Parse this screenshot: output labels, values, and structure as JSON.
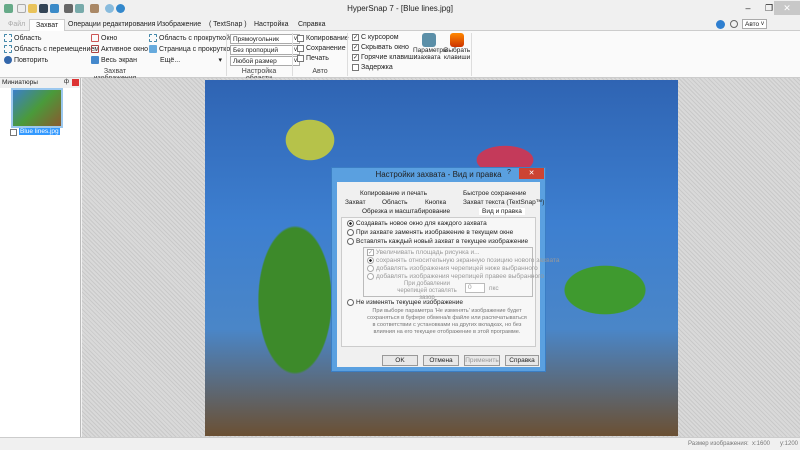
{
  "window": {
    "title": "HyperSnap 7 - [Blue lines.jpg]",
    "min": "–",
    "max": "❐",
    "close": "✕"
  },
  "tabs": [
    "Файл",
    "Захват",
    "Операции редактирования",
    "Изображение",
    "( TextSnap )",
    "Настройка",
    "Справка"
  ],
  "ribbon_right": {
    "zoom": "Авто"
  },
  "ribbon": {
    "capture": {
      "items": [
        "Область",
        "Область с перемещением",
        "Повторить",
        "Окно",
        "Активное окно",
        "Весь экран",
        "Область с прокруткой",
        "Страница с прокруткой",
        "Ещё..."
      ],
      "label": "Захват изображения"
    },
    "region": {
      "selects": [
        "Прямоугольник",
        "Без пропорций",
        "Любой размер"
      ],
      "label": "Настройка области"
    },
    "auto": {
      "items": [
        {
          "label": "Копирование",
          "checked": false
        },
        {
          "label": "Сохранение",
          "checked": false
        },
        {
          "label": "Печать",
          "checked": false
        }
      ],
      "label": "Авто"
    },
    "options": [
      {
        "label": "С курсором",
        "checked": true
      },
      {
        "label": "Скрывать окно",
        "checked": true
      },
      {
        "label": "Горячие клавиши",
        "checked": true
      },
      {
        "label": "Задержка",
        "checked": false
      }
    ],
    "big": [
      "Параметры захвата",
      "Выбрать клавиши"
    ]
  },
  "thumbs": {
    "title": "Миниатюры",
    "pin": "ф",
    "file": "Blue lines.jpg"
  },
  "dialog": {
    "title": "Настройки захвата - Вид и правка",
    "help": "?",
    "close": "✕",
    "tabs_row1": [
      "Копирование и печать",
      "Быстрое сохранение"
    ],
    "tabs_row2": [
      "Захват",
      "Область",
      "Кнопка",
      "Захват текста (TextSnap™)"
    ],
    "tabs_row3": [
      "Обрезка и масштабирование",
      "Вид и правка"
    ],
    "radios": [
      "Создавать новое окно для каждого захвата",
      "При захвате заменять изображение в текущем окне",
      "Вставлять каждый новый захват в текущее изображение"
    ],
    "sub_check": "Увеличивать площадь рисунка и...",
    "sub_radios": [
      "сохранять относительную экранную позицию нового захвата",
      "добавлять изображения черепицей ниже выбранного",
      "добавлять изображения черепицей правее выбранного"
    ],
    "gap_label": "При добавлении черепицей оставлять зазор",
    "gap_value": "0",
    "gap_unit": "пкс",
    "radio_last": "Не изменять текущее изображение",
    "note": "При выборе параметра 'Не изменять' изображение будет сохраняться в буфере обмена/в файле или распечатываться в соответствии с установками на других вкладках, но без влияния на его текущее отображение в этой программе.",
    "buttons": [
      "OK",
      "Отмена",
      "Применить",
      "Справка"
    ]
  },
  "status": {
    "size_label": "Размер изображения:",
    "x": "x:1600",
    "y": "y:1200"
  }
}
